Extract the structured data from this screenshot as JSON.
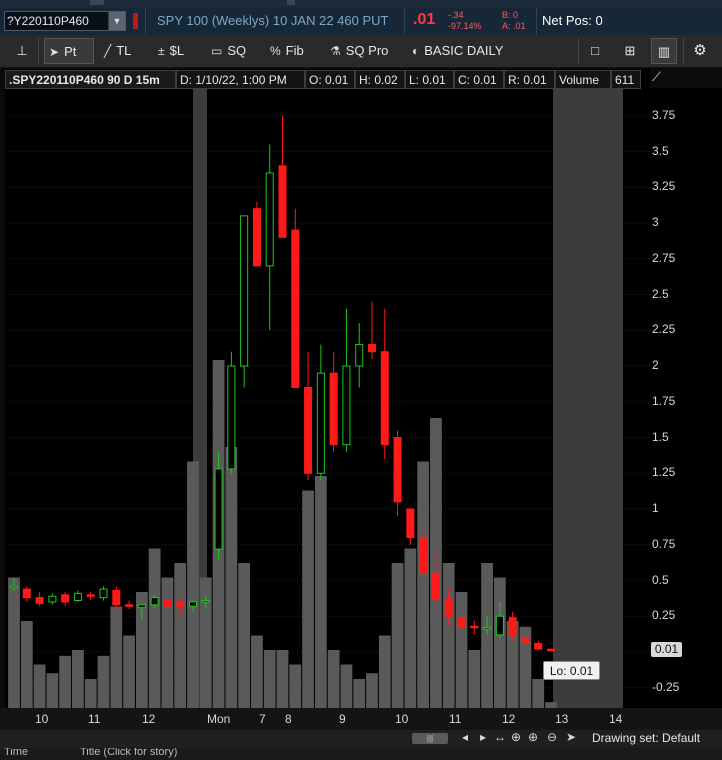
{
  "header": {
    "symbol": "?Y220110P460",
    "description": "SPY 100 (Weeklys) 10 JAN 22 460 PUT",
    "last": ".01",
    "change_abs": "-.34",
    "change_pct": "-97.14%",
    "bid": "B: 0",
    "ask": "A: .01",
    "net_pos": "Net Pos: 0"
  },
  "toolbar": {
    "pt": "Pt",
    "tl": "TL",
    "sl": "$L",
    "sq": "SQ",
    "fib": "Fib",
    "sqpro": "SQ Pro",
    "basic": "BASIC DAILY"
  },
  "infobar": {
    "title": ".SPY220110P460 90 D 15m",
    "date": "D: 1/10/22, 1:00 PM",
    "open": "O: 0.01",
    "high": "H: 0.02",
    "low": "L: 0.01",
    "close": "C: 0.01",
    "range": "R: 0.01",
    "volume_label": "Volume",
    "volume_value": "611"
  },
  "price_badge": "0.01",
  "lo_badge": "Lo: 0.01",
  "status": {
    "drawing_set": "Drawing set: Default",
    "time_label": "Time",
    "title_label": "Title (Click for story)"
  },
  "colors": {
    "up": "#1fc61f",
    "down": "#ff1a1a",
    "volume": "#5a5a5a",
    "shade": "#3c3c3c"
  },
  "chart_data": {
    "type": "candlestick",
    "title": ".SPY220110P460 90 D 15m",
    "yticks": [
      "3.75",
      "3.5",
      "3.25",
      "3",
      "2.75",
      "2.5",
      "2.25",
      "2",
      "1.75",
      "1.5",
      "1.25",
      "1",
      "0.75",
      "0.5",
      "0.25",
      "0",
      "-0.25"
    ],
    "ylim": [
      -0.3,
      3.95
    ],
    "xlabels": [
      "10",
      "11",
      "12",
      "Mon",
      "7",
      "8",
      "9",
      "10",
      "11",
      "12",
      "13",
      "14"
    ],
    "candles": [
      {
        "o": 0.45,
        "h": 0.52,
        "l": 0.43,
        "c": 0.46,
        "v": 0.45
      },
      {
        "o": 0.44,
        "h": 0.46,
        "l": 0.35,
        "c": 0.38,
        "v": 0.3
      },
      {
        "o": 0.38,
        "h": 0.42,
        "l": 0.32,
        "c": 0.34,
        "v": 0.15
      },
      {
        "o": 0.35,
        "h": 0.41,
        "l": 0.33,
        "c": 0.39,
        "v": 0.12
      },
      {
        "o": 0.4,
        "h": 0.42,
        "l": 0.32,
        "c": 0.35,
        "v": 0.18
      },
      {
        "o": 0.36,
        "h": 0.43,
        "l": 0.35,
        "c": 0.41,
        "v": 0.2
      },
      {
        "o": 0.4,
        "h": 0.42,
        "l": 0.36,
        "c": 0.39,
        "v": 0.1
      },
      {
        "o": 0.38,
        "h": 0.46,
        "l": 0.36,
        "c": 0.44,
        "v": 0.18
      },
      {
        "o": 0.43,
        "h": 0.46,
        "l": 0.3,
        "c": 0.33,
        "v": 0.35
      },
      {
        "o": 0.33,
        "h": 0.36,
        "l": 0.3,
        "c": 0.32,
        "v": 0.25
      },
      {
        "o": 0.31,
        "h": 0.33,
        "l": 0.23,
        "c": 0.33,
        "v": 0.4
      },
      {
        "o": 0.33,
        "h": 0.4,
        "l": 0.31,
        "c": 0.38,
        "v": 0.55
      },
      {
        "o": 0.36,
        "h": 0.38,
        "l": 0.3,
        "c": 0.32,
        "v": 0.45
      },
      {
        "o": 0.35,
        "h": 0.38,
        "l": 0.25,
        "c": 0.32,
        "v": 0.5
      },
      {
        "o": 0.32,
        "h": 0.36,
        "l": 0.28,
        "c": 0.35,
        "v": 0.85
      },
      {
        "o": 0.35,
        "h": 0.4,
        "l": 0.3,
        "c": 0.36,
        "v": 0.45
      },
      {
        "o": 0.72,
        "h": 1.4,
        "l": 0.65,
        "c": 1.28,
        "v": 1.2
      },
      {
        "o": 1.28,
        "h": 2.1,
        "l": 1.25,
        "c": 2.0,
        "v": 0.9
      },
      {
        "o": 2.0,
        "h": 3.05,
        "l": 1.85,
        "c": 3.05,
        "v": 0.5
      },
      {
        "o": 3.1,
        "h": 3.15,
        "l": 2.7,
        "c": 2.7,
        "v": 0.25
      },
      {
        "o": 2.7,
        "h": 3.55,
        "l": 2.25,
        "c": 3.35,
        "v": 0.2
      },
      {
        "o": 3.4,
        "h": 3.75,
        "l": 2.9,
        "c": 2.9,
        "v": 0.2
      },
      {
        "o": 2.95,
        "h": 3.1,
        "l": 1.95,
        "c": 1.85,
        "v": 0.15
      },
      {
        "o": 1.85,
        "h": 2.1,
        "l": 1.2,
        "c": 1.25,
        "v": 0.75
      },
      {
        "o": 1.25,
        "h": 2.15,
        "l": 1.2,
        "c": 1.95,
        "v": 0.8
      },
      {
        "o": 1.95,
        "h": 2.1,
        "l": 1.4,
        "c": 1.45,
        "v": 0.2
      },
      {
        "o": 1.45,
        "h": 2.4,
        "l": 1.4,
        "c": 2.0,
        "v": 0.15
      },
      {
        "o": 2.0,
        "h": 2.3,
        "l": 1.85,
        "c": 2.15,
        "v": 0.1
      },
      {
        "o": 2.15,
        "h": 2.45,
        "l": 2.05,
        "c": 2.1,
        "v": 0.12
      },
      {
        "o": 2.1,
        "h": 2.4,
        "l": 1.35,
        "c": 1.45,
        "v": 0.25
      },
      {
        "o": 1.5,
        "h": 1.55,
        "l": 0.95,
        "c": 1.05,
        "v": 0.5
      },
      {
        "o": 1.0,
        "h": 1.0,
        "l": 0.75,
        "c": 0.8,
        "v": 0.55
      },
      {
        "o": 0.8,
        "h": 0.85,
        "l": 0.55,
        "c": 0.55,
        "v": 0.85
      },
      {
        "o": 0.55,
        "h": 0.7,
        "l": 0.35,
        "c": 0.37,
        "v": 1.0
      },
      {
        "o": 0.37,
        "h": 0.45,
        "l": 0.19,
        "c": 0.25,
        "v": 0.5
      },
      {
        "o": 0.24,
        "h": 0.28,
        "l": 0.15,
        "c": 0.17,
        "v": 0.4
      },
      {
        "o": 0.18,
        "h": 0.22,
        "l": 0.12,
        "c": 0.17,
        "v": 0.2
      },
      {
        "o": 0.16,
        "h": 0.25,
        "l": 0.12,
        "c": 0.17,
        "v": 0.5
      },
      {
        "o": 0.12,
        "h": 0.35,
        "l": 0.1,
        "c": 0.25,
        "v": 0.45
      },
      {
        "o": 0.24,
        "h": 0.28,
        "l": 0.08,
        "c": 0.12,
        "v": 0.3
      },
      {
        "o": 0.1,
        "h": 0.12,
        "l": 0.05,
        "c": 0.06,
        "v": 0.28
      },
      {
        "o": 0.06,
        "h": 0.08,
        "l": 0.01,
        "c": 0.02,
        "v": 0.1
      },
      {
        "o": 0.02,
        "h": 0.02,
        "l": 0.01,
        "c": 0.01,
        "v": 0.02
      }
    ]
  }
}
